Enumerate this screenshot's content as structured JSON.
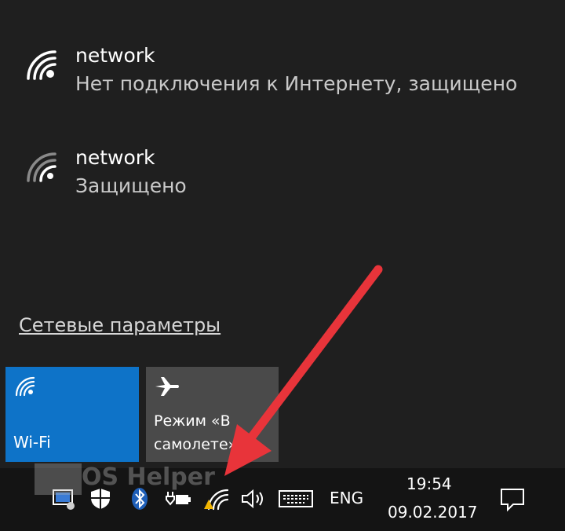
{
  "networks": [
    {
      "name": "network",
      "status": "Нет подключения к Интернету, защищено",
      "icon": "wifi-icon"
    },
    {
      "name": "network",
      "status": "Защищено",
      "icon": "wifi-icon"
    }
  ],
  "settings_link": "Сетевые параметры",
  "tiles": {
    "wifi": {
      "label": "Wi-Fi",
      "icon": "wifi-icon",
      "color": "#0e73c8"
    },
    "airplane": {
      "label": "Режим «В самолете»",
      "icon": "airplane-icon",
      "color": "#4a4a4a"
    }
  },
  "taskbar": {
    "language": "ENG",
    "time": "19:54",
    "date": "09.02.2017",
    "icons": [
      "app-icon",
      "defender-icon",
      "bluetooth-icon",
      "power-icon",
      "network-warning-icon",
      "volume-icon",
      "keyboard-icon",
      "notification-icon"
    ]
  },
  "watermark": "OS Helper",
  "annotation": {
    "color": "#e8343a"
  }
}
